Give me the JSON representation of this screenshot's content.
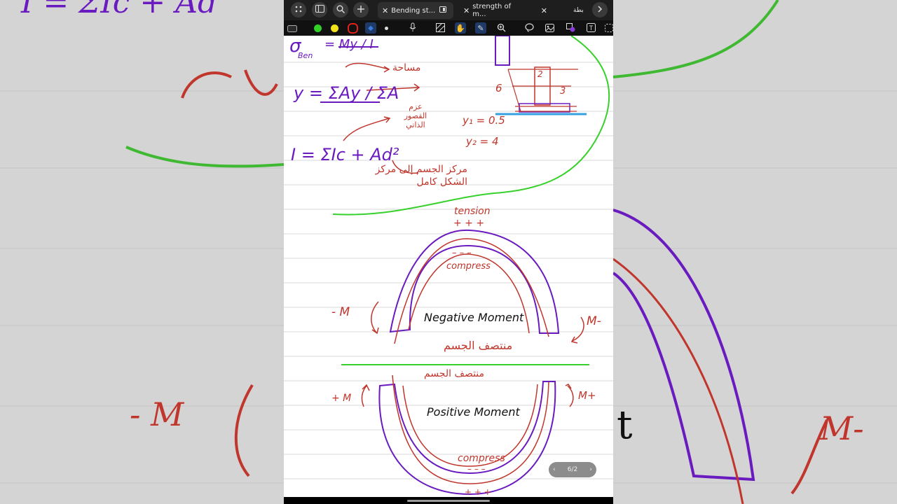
{
  "tabs": [
    {
      "label": "Bending st...",
      "active": true
    },
    {
      "label": "strength of m...",
      "active": false
    }
  ],
  "tab_overflow_label": "بطة",
  "pager": {
    "label": "6/2"
  },
  "notes": {
    "formula_sigma": "σ",
    "formula_sigma_sub": "Ben",
    "formula_sigma_rhs": "= My / I",
    "formula_y": "y = ΣAy / ΣA",
    "formula_i": "I = ΣIc + Ad²",
    "arabic_area": "مساحة",
    "arabic_moment": "عزم القصور الذاتي",
    "arabic_centroid": "مركز الجسم إلى مركز الشكل كامل",
    "shape_label_6": "6",
    "shape_label_2": "2",
    "shape_label_3": "3",
    "y1": "y₁ = 0.5",
    "y2": "y₂ = 4",
    "tension": "tension",
    "plus_top": "+ + +",
    "minus_top": "– – –",
    "compress_top": "compress",
    "neg_moment": "Negative Moment",
    "left_m_neg": "- M",
    "right_m_neg": "M-",
    "arabic_mid_top": "منتصف الجسم",
    "arabic_mid_bottom": "منتصف الجسم",
    "pos_moment": "Positive Moment",
    "left_m_pos": "+ M",
    "right_m_pos": "M+",
    "compress_bottom": "compress",
    "minus_bottom": "– – –",
    "plus_bottom": "+ + +"
  },
  "backdrop": {
    "formula": "I = ΣIc + Ad",
    "left_m": "- M",
    "right_m": "M-",
    "t_letter": "t"
  },
  "colors": {
    "purple": "#6a1bbf",
    "red": "#c0362c",
    "green": "#38d12c",
    "blue": "#35a0e0",
    "black": "#111111"
  }
}
